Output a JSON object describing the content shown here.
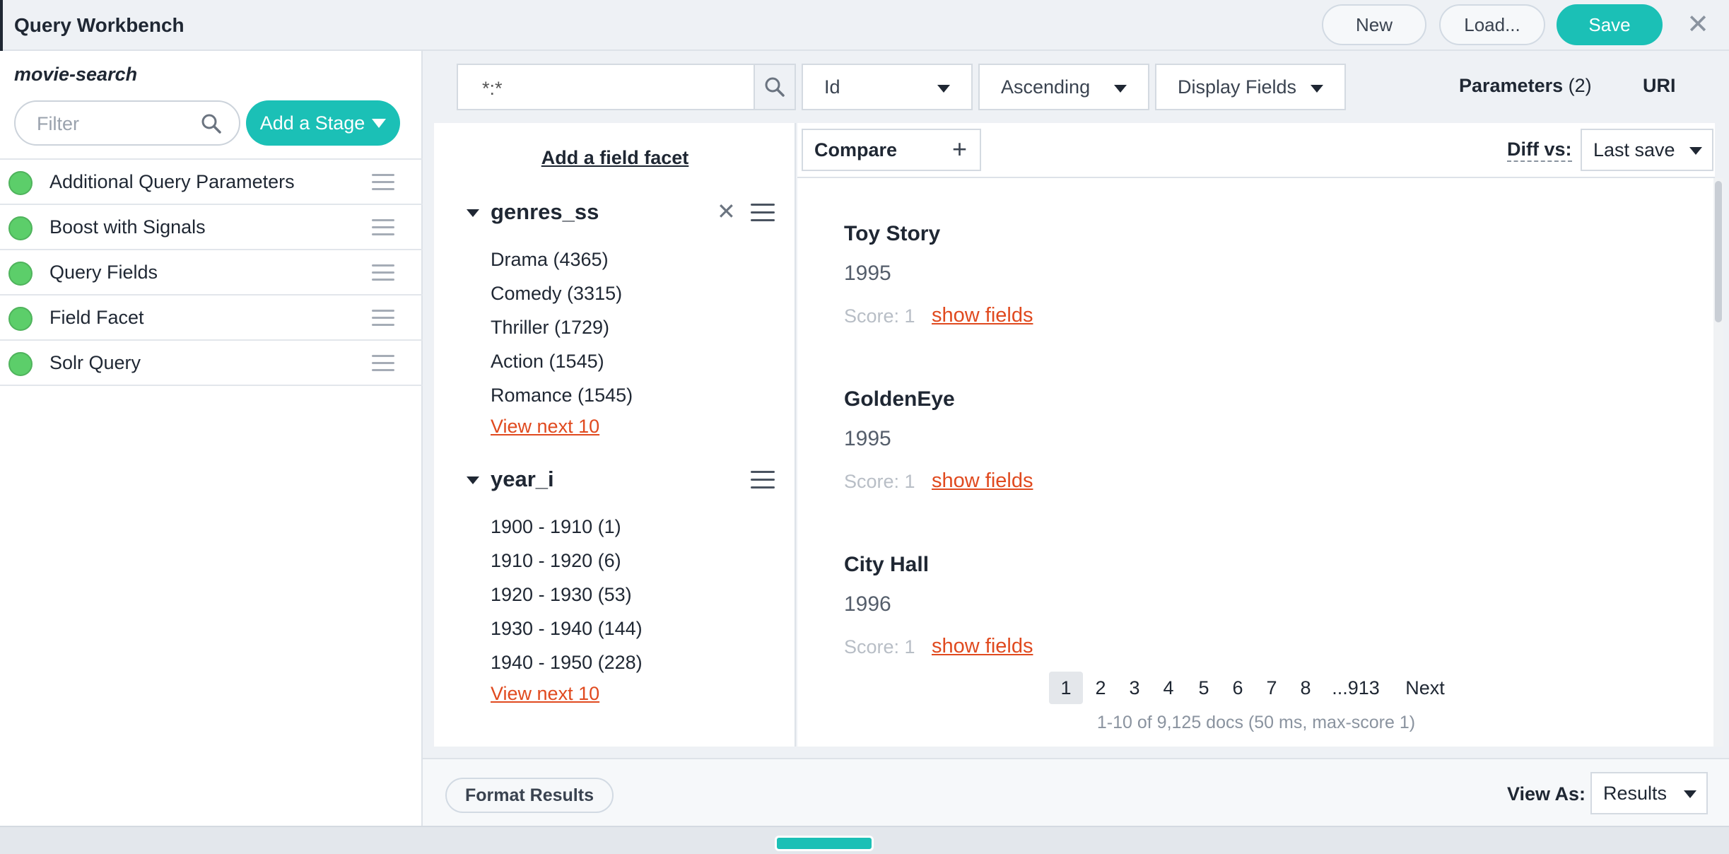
{
  "header": {
    "title": "Query Workbench",
    "new_label": "New",
    "load_label": "Load...",
    "save_label": "Save",
    "close_icon": "close-icon",
    "accent_color": "#1bc0b6"
  },
  "pipeline": {
    "name": "movie-search",
    "filter_placeholder": "Filter",
    "add_stage_label": "Add a Stage",
    "stages": [
      {
        "label": "Additional Query Parameters",
        "status_color": "#5cce6a"
      },
      {
        "label": "Boost with Signals",
        "status_color": "#5cce6a"
      },
      {
        "label": "Query Fields",
        "status_color": "#5cce6a"
      },
      {
        "label": "Field Facet",
        "status_color": "#5cce6a"
      },
      {
        "label": "Solr Query",
        "status_color": "#5cce6a"
      }
    ]
  },
  "query": {
    "value": "*:*",
    "sort_field": "Id",
    "sort_order": "Ascending",
    "display_fields": "Display Fields",
    "parameters_label": "Parameters",
    "parameters_count": "(2)",
    "uri_label": "URI"
  },
  "facets": {
    "add_label": "Add a field facet",
    "groups": [
      {
        "name": "genres_ss",
        "items": [
          "Drama (4365)",
          "Comedy (3315)",
          "Thriller (1729)",
          "Action (1545)",
          "Romance (1545)"
        ],
        "view_next": "View next 10"
      },
      {
        "name": "year_i",
        "items": [
          "1900 - 1910 (1)",
          "1910 - 1920 (6)",
          "1920 - 1930 (53)",
          "1930 - 1940 (144)",
          "1940 - 1950 (228)"
        ],
        "view_next": "View next 10"
      }
    ]
  },
  "results": {
    "compare_label": "Compare",
    "diff_label": "Diff vs:",
    "diff_value": "Last save",
    "docs": [
      {
        "title": "Toy Story",
        "year": "1995",
        "score": "Score: 1",
        "show_fields": "show fields"
      },
      {
        "title": "GoldenEye",
        "year": "1995",
        "score": "Score: 1",
        "show_fields": "show fields"
      },
      {
        "title": "City Hall",
        "year": "1996",
        "score": "Score: 1",
        "show_fields": "show fields"
      }
    ],
    "pages": [
      "1",
      "2",
      "3",
      "4",
      "5",
      "6",
      "7",
      "8",
      "...913",
      "Next"
    ],
    "current_page": "1",
    "summary": "1-10 of 9,125 docs (50 ms, max-score 1)"
  },
  "footer": {
    "format_label": "Format Results",
    "view_as_label": "View As:",
    "view_as_value": "Results"
  }
}
